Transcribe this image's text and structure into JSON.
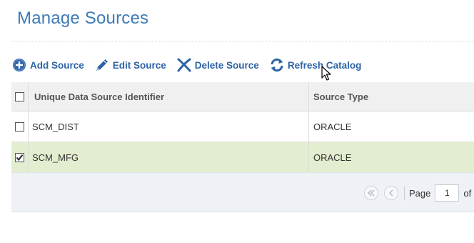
{
  "page": {
    "title": "Manage Sources"
  },
  "toolbar": {
    "add_label": "Add Source",
    "edit_label": "Edit Source",
    "delete_label": "Delete Source",
    "refresh_label": "Refresh Catalog"
  },
  "grid": {
    "columns": [
      "Unique Data Source Identifier",
      "Source Type"
    ],
    "rows": [
      {
        "id": "SCM_DIST",
        "type": "ORACLE",
        "checked": false
      },
      {
        "id": "SCM_MFG",
        "type": "ORACLE",
        "checked": true
      }
    ],
    "selected_row_color": "#e3edcf"
  },
  "pager": {
    "page_label": "Page",
    "current_page": "1",
    "of_label": "of"
  },
  "colors": {
    "accent": "#3d7ab8",
    "link": "#2e63a6"
  },
  "icons": [
    "add-circle-icon",
    "pencil-icon",
    "delete-x-icon",
    "refresh-icon",
    "first-page-icon",
    "prev-page-icon",
    "mouse-cursor-icon"
  ]
}
